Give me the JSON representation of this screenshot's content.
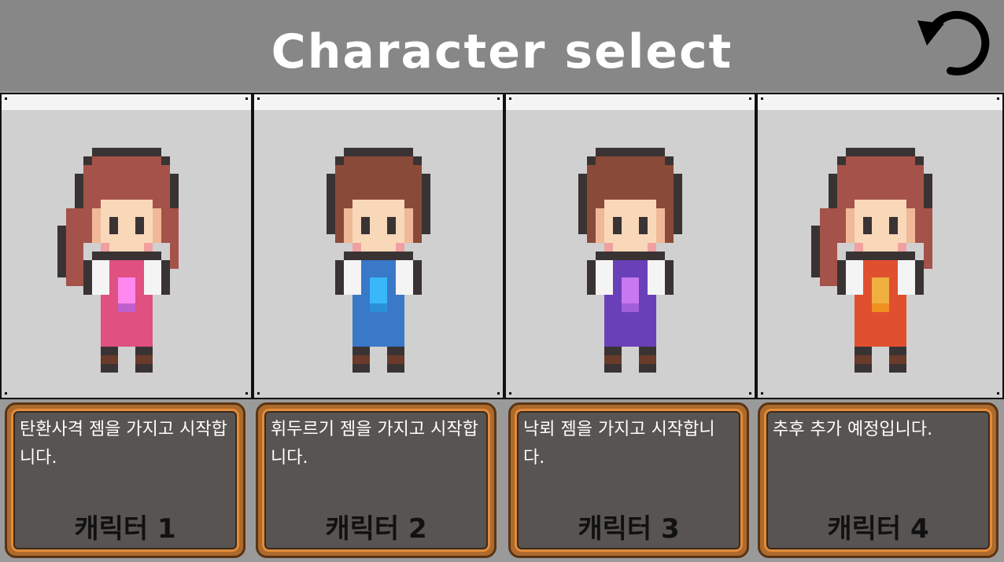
{
  "header": {
    "title": "Character select",
    "back_icon": "undo-arrow-icon"
  },
  "characters": [
    {
      "name": "캐릭터 1",
      "description": "탄환사격 젬을 가지고 시작합니다.",
      "hair": "#a5524a",
      "outfit": "#e05080",
      "gem": "#ff88f0",
      "gem_shade": "#c060d0"
    },
    {
      "name": "캐릭터 2",
      "description": "휘두르기 젬을 가지고 시작합니다.",
      "hair": "#8a4a3a",
      "outfit": "#3a78c8",
      "gem": "#38b8f8",
      "gem_shade": "#2a90d8"
    },
    {
      "name": "캐릭터 3",
      "description": "낙뢰 젬을 가지고 시작합니다.",
      "hair": "#8a4a3a",
      "outfit": "#6a40b8",
      "gem": "#c878f0",
      "gem_shade": "#a060d8"
    },
    {
      "name": "캐릭터 4",
      "description": "추후 추가 예정입니다.",
      "hair": "#a5524a",
      "outfit": "#e0502e",
      "gem": "#f0b040",
      "gem_shade": "#f09020"
    }
  ]
}
